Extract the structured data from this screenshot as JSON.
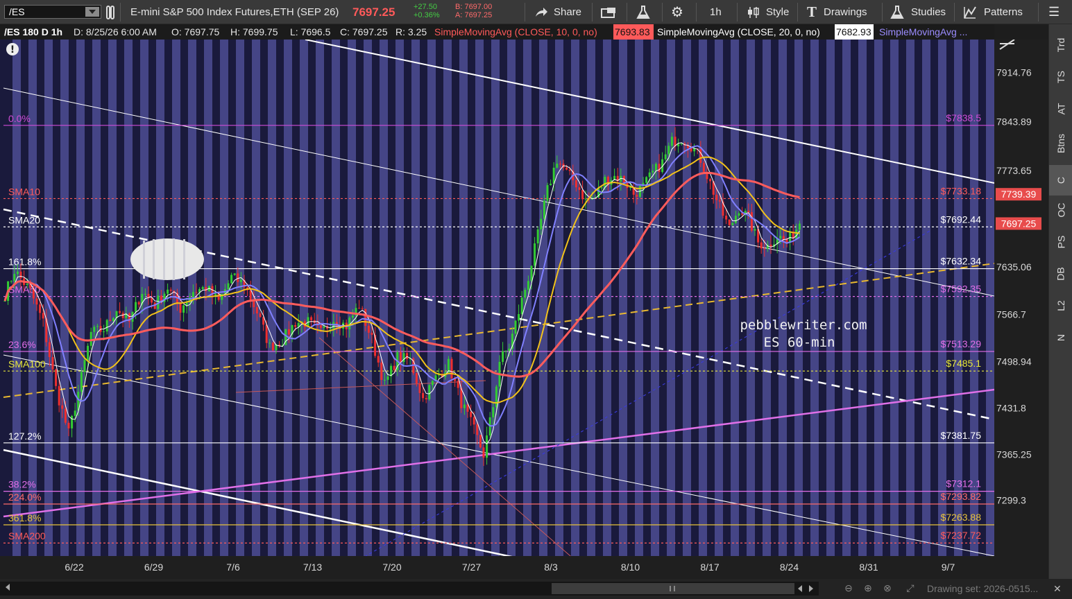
{
  "toolbar": {
    "symbol": "/ES",
    "instrument": "E-mini S&P 500 Index Futures,ETH (SEP 26)",
    "last_price": "7697.25",
    "change": "+27.50",
    "change_pct": "+0.36%",
    "bid": "B: 7697.00",
    "ask": "A: 7697.25",
    "share_label": "Share",
    "timeframe": "1h",
    "style_label": "Style",
    "drawings_label": "Drawings",
    "studies_label": "Studies",
    "patterns_label": "Patterns"
  },
  "info_bar": {
    "title": "/ES 180 D 1h",
    "date": "D: 8/25/26 6:00 AM",
    "open": "O: 7697.75",
    "high": "H: 7699.75",
    "low": "L: 7696.5",
    "close": "C: 7697.25",
    "range": "R: 3.25",
    "sma10_label": "SimpleMovingAvg (CLOSE, 10, 0, no)",
    "sma10_value": "7693.83",
    "sma20_label": "SimpleMovingAvg (CLOSE, 20, 0, no)",
    "sma20_value": "7682.93",
    "sma50_label": "SimpleMovingAvg ..."
  },
  "chart_data": {
    "type": "candlestick",
    "symbol": "/ES",
    "interval": "1h",
    "x_ticks": [
      "6/22",
      "6/29",
      "7/6",
      "7/13",
      "7/20",
      "7/27",
      "8/3",
      "8/10",
      "8/17",
      "8/24",
      "8/31",
      "9/7"
    ],
    "y_ticks": [
      "7914.76",
      "7843.89",
      "7773.65",
      "7635.06",
      "7566.7",
      "7498.94",
      "7431.8",
      "7365.25",
      "7299.3"
    ],
    "ylim": [
      7219,
      7962
    ],
    "price_bubbles": [
      {
        "label": "7739.39",
        "color": "#e84c4c"
      },
      {
        "label": "7697.25",
        "color": "#e84c4c"
      }
    ],
    "levels": [
      {
        "left_label": "0.0%",
        "right_label": "$7838.5",
        "price": 7838.5,
        "color": "#d04cd8",
        "style": "solid"
      },
      {
        "left_label": "SMA10",
        "right_label": "$7733.18",
        "price": 7733.18,
        "color": "#ff5a5a",
        "style": "dotted"
      },
      {
        "left_label": "SMA20",
        "right_label": "$7692.44",
        "price": 7692.44,
        "color": "#ffffff",
        "style": "dotted"
      },
      {
        "left_label": "161.8%",
        "right_label": "$7632.34",
        "price": 7632.34,
        "color": "#ffffff",
        "style": "solid"
      },
      {
        "left_label": "SMA50",
        "right_label": "$7592.35",
        "price": 7592.35,
        "color": "#e26ee8",
        "style": "dotted"
      },
      {
        "left_label": "23.6%",
        "right_label": "$7513.29",
        "price": 7513.29,
        "color": "#e26ee8",
        "style": "solid"
      },
      {
        "left_label": "SMA100",
        "right_label": "$7485.1",
        "price": 7485.1,
        "color": "#e8e83a",
        "style": "dotted"
      },
      {
        "left_label": "127.2%",
        "right_label": "$7381.75",
        "price": 7381.75,
        "color": "#ffffff",
        "style": "solid"
      },
      {
        "left_label": "38.2%",
        "right_label": "$7312.1",
        "price": 7312.1,
        "color": "#e26ee8",
        "style": "solid"
      },
      {
        "left_label": "224.0%",
        "right_label": "$7293.82",
        "price": 7293.82,
        "color": "#ff6a6a",
        "style": "solid"
      },
      {
        "left_label": "361.8%",
        "right_label": "$7263.88",
        "price": 7263.88,
        "color": "#e8c23a",
        "style": "solid"
      },
      {
        "left_label": "SMA200",
        "right_label": "$7237.72",
        "price": 7237.72,
        "color": "#ff5a5a",
        "style": "dotted"
      }
    ],
    "series": [
      {
        "name": "SMA10",
        "color": "#8080ff"
      },
      {
        "name": "SMA20",
        "color": "#f2c21a"
      },
      {
        "name": "SMA50",
        "color": "#ff5c5c"
      }
    ],
    "close_anchors": [
      [
        0,
        7595
      ],
      [
        3,
        7630
      ],
      [
        8,
        7600
      ],
      [
        12,
        7555
      ],
      [
        16,
        7460
      ],
      [
        20,
        7395
      ],
      [
        23,
        7455
      ],
      [
        27,
        7540
      ],
      [
        31,
        7545
      ],
      [
        35,
        7575
      ],
      [
        39,
        7555
      ],
      [
        43,
        7600
      ],
      [
        47,
        7580
      ],
      [
        51,
        7605
      ],
      [
        55,
        7575
      ],
      [
        59,
        7600
      ],
      [
        63,
        7605
      ],
      [
        67,
        7585
      ],
      [
        71,
        7620
      ],
      [
        75,
        7610
      ],
      [
        79,
        7570
      ],
      [
        83,
        7520
      ],
      [
        87,
        7530
      ],
      [
        91,
        7555
      ],
      [
        95,
        7555
      ],
      [
        99,
        7540
      ],
      [
        103,
        7560
      ],
      [
        107,
        7550
      ],
      [
        111,
        7580
      ],
      [
        115,
        7530
      ],
      [
        119,
        7465
      ],
      [
        123,
        7505
      ],
      [
        127,
        7500
      ],
      [
        131,
        7445
      ],
      [
        135,
        7475
      ],
      [
        139,
        7495
      ],
      [
        143,
        7440
      ],
      [
        147,
        7400
      ],
      [
        150,
        7365
      ],
      [
        153,
        7435
      ],
      [
        155,
        7500
      ],
      [
        158,
        7520
      ],
      [
        161,
        7570
      ],
      [
        164,
        7620
      ],
      [
        167,
        7680
      ],
      [
        170,
        7745
      ],
      [
        173,
        7790
      ],
      [
        176,
        7770
      ],
      [
        179,
        7755
      ],
      [
        182,
        7730
      ],
      [
        185,
        7735
      ],
      [
        188,
        7760
      ],
      [
        191,
        7765
      ],
      [
        194,
        7760
      ],
      [
        197,
        7740
      ],
      [
        200,
        7750
      ],
      [
        203,
        7770
      ],
      [
        206,
        7785
      ],
      [
        209,
        7815
      ],
      [
        212,
        7820
      ],
      [
        215,
        7810
      ],
      [
        218,
        7790
      ],
      [
        221,
        7755
      ],
      [
        224,
        7720
      ],
      [
        227,
        7690
      ],
      [
        230,
        7720
      ],
      [
        233,
        7705
      ],
      [
        236,
        7670
      ],
      [
        239,
        7665
      ],
      [
        242,
        7680
      ],
      [
        245,
        7670
      ],
      [
        248,
        7690
      ],
      [
        249,
        7697.25
      ]
    ],
    "watermark": [
      "pebblewriter.com",
      "ES 60-min"
    ],
    "annotations": []
  },
  "right_panel": [
    "Trd",
    "TS",
    "AT",
    "Btns",
    "C",
    "OC",
    "PS",
    "DB",
    "L2",
    "N"
  ],
  "status": {
    "drawing_set": "Drawing set: 2026-0515..."
  }
}
